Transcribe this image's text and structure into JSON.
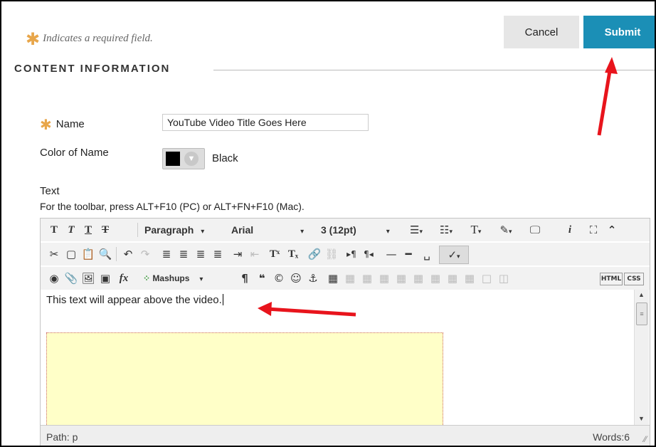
{
  "header": {
    "required_note": "Indicates a required field.",
    "required_star": "✱",
    "cancel_label": "Cancel",
    "submit_label": "Submit"
  },
  "section": {
    "title": "CONTENT INFORMATION"
  },
  "form": {
    "name_label": "Name",
    "name_value": "YouTube Video Title Goes Here",
    "color_label": "Color of Name",
    "color_value": "Black",
    "text_label": "Text",
    "toolbar_hint": "For the toolbar, press ALT+F10 (PC) or ALT+FN+F10 (Mac)."
  },
  "editor": {
    "paragraph_dd": "Paragraph",
    "font_dd": "Arial",
    "size_dd": "3 (12pt)",
    "mashups_dd": "Mashups",
    "content_text": "This text will appear above the video.",
    "path_label": "Path: p",
    "words_label": "Words:6"
  },
  "colors": {
    "accent": "#1b8fb6",
    "required_star": "#e8a64a",
    "arrow": "#e8141c",
    "video_placeholder": "#ffffc8"
  }
}
